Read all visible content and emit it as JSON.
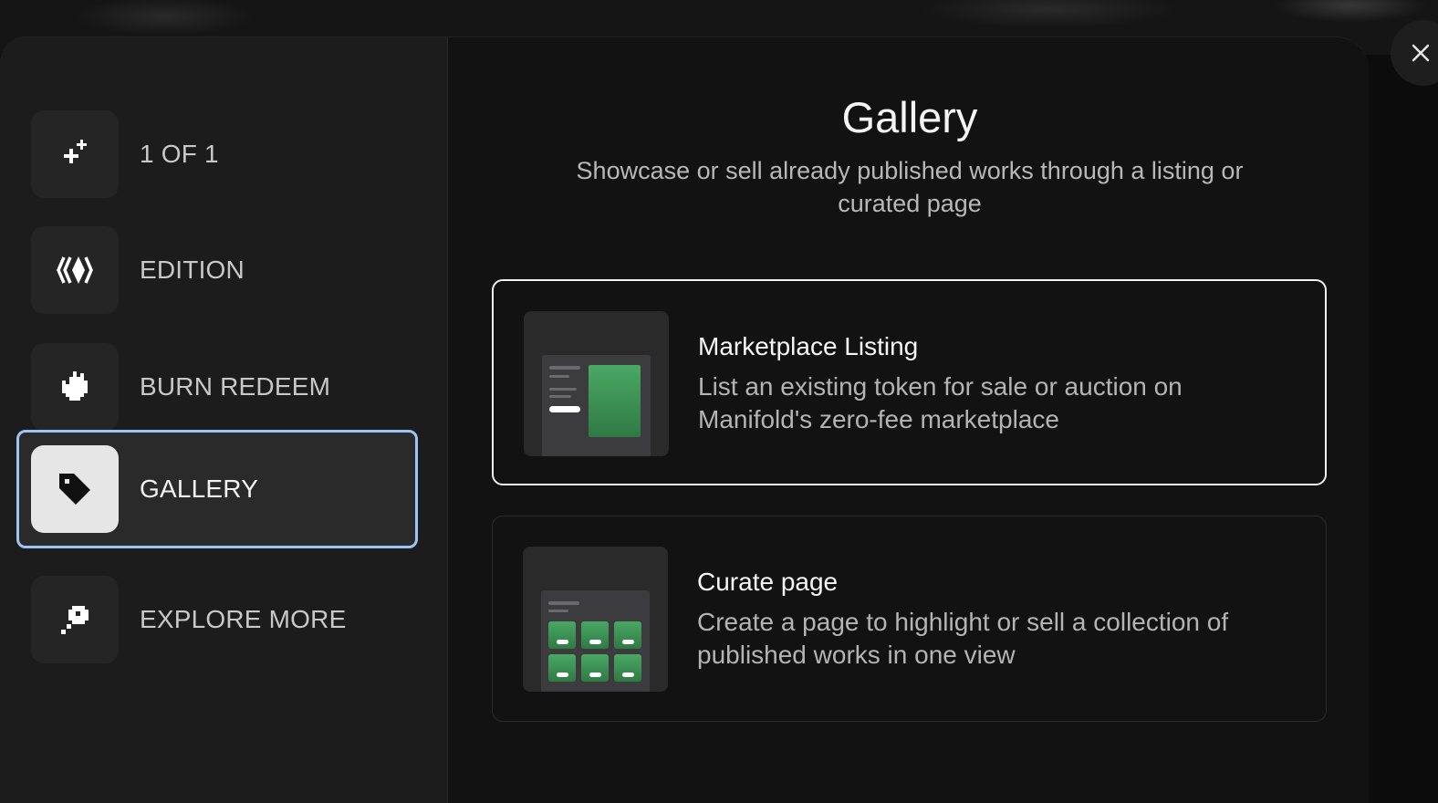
{
  "sidebar": {
    "items": [
      {
        "label": "1 OF 1",
        "icon": "sparkle-icon",
        "active": false
      },
      {
        "label": "EDITION",
        "icon": "edition-waves-icon",
        "active": false
      },
      {
        "label": "BURN REDEEM",
        "icon": "fire-icon",
        "active": false
      },
      {
        "label": "GALLERY",
        "icon": "tag-icon",
        "active": true
      },
      {
        "label": "EXPLORE MORE",
        "icon": "explore-icon",
        "active": false
      }
    ]
  },
  "main": {
    "title": "Gallery",
    "subtitle": "Showcase or sell already published works through a listing or curated page",
    "options": [
      {
        "title": "Marketplace Listing",
        "description": "List an existing token for sale or auction on Manifold's zero-fee marketplace",
        "selected": true,
        "thumbnail": "listing-thumbnail"
      },
      {
        "title": "Curate page",
        "description": "Create a page to highlight or sell a collection of published works in one view",
        "selected": false,
        "thumbnail": "curate-thumbnail"
      }
    ]
  },
  "close": {
    "icon": "close-icon"
  },
  "colors": {
    "active_border": "#9ec3f5",
    "thumbnail_green": "#3f9a56",
    "selected_card_border": "#f2f2f2"
  }
}
